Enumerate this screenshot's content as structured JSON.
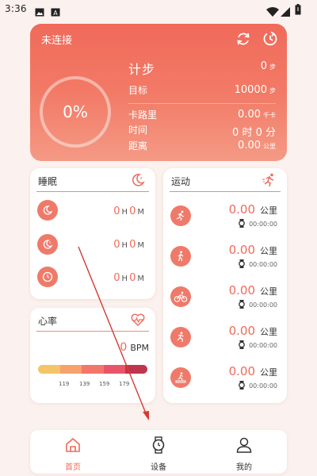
{
  "status_bar": {
    "time": "3:36"
  },
  "hero": {
    "connection_status": "未连接",
    "progress_percent": "0%",
    "progress_value": 0,
    "steps_label": "计步",
    "steps_value": "0",
    "steps_unit": "步",
    "goal_label": "目标",
    "goal_value": "10000",
    "goal_unit": "步",
    "calories_label": "卡路里",
    "calories_value": "0.00",
    "calories_unit": "千卡",
    "time_label": "时间",
    "time_value": "0 时 0 分",
    "distance_label": "距离",
    "distance_value": "0.00",
    "distance_unit": "公里"
  },
  "sleep": {
    "title": "睡眠",
    "rows": [
      {
        "hours": "0",
        "h_unit": "H",
        "minutes": "0",
        "m_unit": "M"
      },
      {
        "hours": "0",
        "h_unit": "H",
        "minutes": "0",
        "m_unit": "M"
      },
      {
        "hours": "0",
        "h_unit": "H",
        "minutes": "0",
        "m_unit": "M"
      }
    ]
  },
  "sport": {
    "title": "运动",
    "rows": [
      {
        "value": "0.00",
        "unit": "公里",
        "duration": "00:00:00"
      },
      {
        "value": "0.00",
        "unit": "公里",
        "duration": "00:00:00"
      },
      {
        "value": "0.00",
        "unit": "公里",
        "duration": "00:00:00"
      },
      {
        "value": "0.00",
        "unit": "公里",
        "duration": "00:00:00"
      },
      {
        "value": "0.00",
        "unit": "公里",
        "duration": "00:00:00"
      }
    ]
  },
  "heart_rate": {
    "title": "心率",
    "value": "0",
    "unit": "BPM",
    "ticks": [
      "119",
      "139",
      "159",
      "179"
    ],
    "zone_colors": [
      "#f4c468",
      "#f6a26a",
      "#f2766a",
      "#e8556a",
      "#c0354e"
    ]
  },
  "nav": {
    "items": [
      {
        "label": "首页",
        "active": true
      },
      {
        "label": "设备",
        "active": false
      },
      {
        "label": "我的",
        "active": false
      }
    ]
  },
  "colors": {
    "accent": "#ef6a5a",
    "nav_active": "#ef6a5a"
  }
}
